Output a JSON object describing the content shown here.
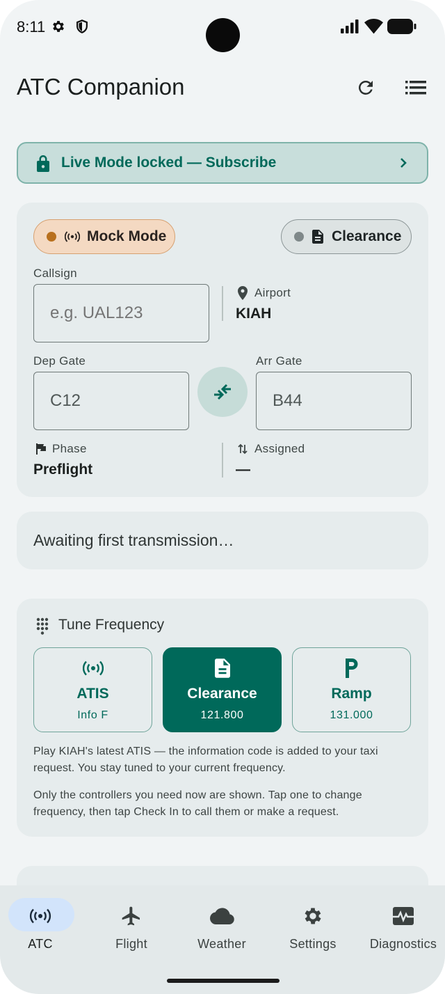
{
  "status_bar": {
    "time": "8:11"
  },
  "app": {
    "title": "ATC Companion"
  },
  "banner": {
    "text": "Live Mode locked — Subscribe"
  },
  "session": {
    "mode_chip": "Mock Mode",
    "frequency_chip": "Clearance",
    "callsign_label": "Callsign",
    "callsign_placeholder": "e.g. UAL123",
    "airport_label": "Airport",
    "airport_value": "KIAH",
    "dep_gate_label": "Dep Gate",
    "dep_gate_value": "C12",
    "arr_gate_label": "Arr Gate",
    "arr_gate_value": "B44",
    "phase_label": "Phase",
    "phase_value": "Preflight",
    "assigned_label": "Assigned",
    "assigned_value": "—"
  },
  "transmission": {
    "text": "Awaiting first transmission…"
  },
  "tune": {
    "title": "Tune Frequency",
    "options": [
      {
        "name": "ATIS",
        "value": "Info F",
        "icon": "radio-waves-icon",
        "active": false
      },
      {
        "name": "Clearance",
        "value": "121.800",
        "icon": "document-icon",
        "active": true
      },
      {
        "name": "Ramp",
        "value": "131.000",
        "icon": "parking-p-icon",
        "active": false
      }
    ],
    "description_1": "Play KIAH's latest ATIS — the information code is added to your taxi request. You stay tuned to your current frequency.",
    "description_2": "Only the controllers you need now are shown. Tap one to change frequency, then tap Check In to call them or make a request."
  },
  "nav": {
    "items": [
      {
        "label": "ATC",
        "icon": "radio-waves-icon",
        "selected": true
      },
      {
        "label": "Flight",
        "icon": "airplane-icon",
        "selected": false
      },
      {
        "label": "Weather",
        "icon": "cloud-icon",
        "selected": false
      },
      {
        "label": "Settings",
        "icon": "gear-icon",
        "selected": false
      },
      {
        "label": "Diagnostics",
        "icon": "monitor-heart-icon",
        "selected": false
      }
    ]
  },
  "colors": {
    "accent": "#00695a",
    "banner_bg": "#c8dedb",
    "mock_chip_bg": "#f4d9c2",
    "mock_dot": "#b8701e",
    "nav_selected_pill": "#d2e4fb"
  }
}
